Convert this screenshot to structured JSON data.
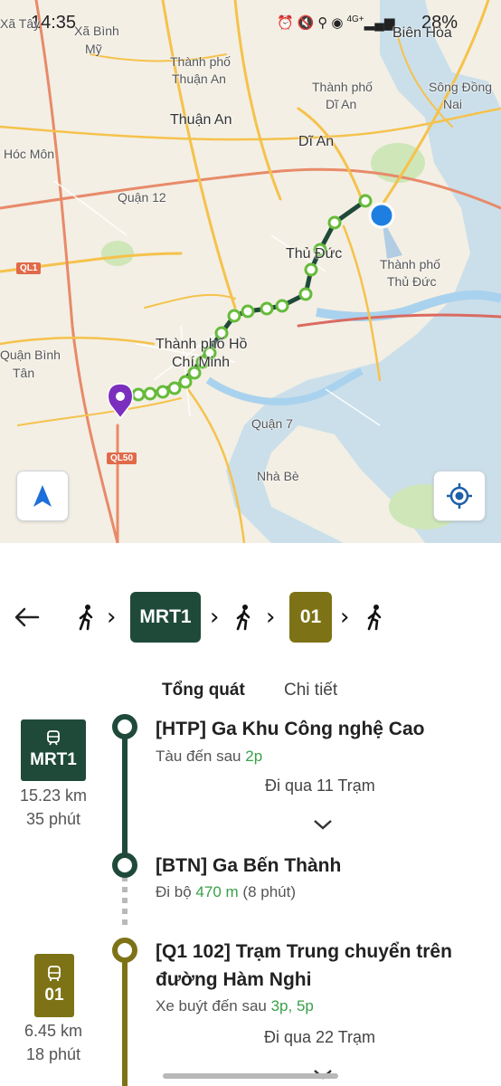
{
  "status_bar": {
    "time": "14:35",
    "signal_label": "4G+",
    "battery": "28%"
  },
  "map": {
    "labels": [
      "Xã Tây",
      "Xã Bình",
      "Mỹ",
      "Thành phố",
      "Thuận An",
      "Thuận An",
      "Thành phố",
      "Dĩ An",
      "Dĩ An",
      "Biên Hòa",
      "Sông Đồng",
      "Nai",
      "Hóc Môn",
      "Quận 12",
      "Thủ Đức",
      "Thành phố",
      "Thủ Đức",
      "Thành phố Hồ",
      "Chí Minh",
      "Quận Bình",
      "Tân",
      "Quận 7",
      "Nhà Bè"
    ],
    "shields": [
      "QL1",
      "QL50"
    ],
    "colors": {
      "route": "#1f4a3a",
      "walk": "#66bb3a",
      "origin": "#7b2fbe",
      "current": "#1e7fe0"
    },
    "navigate_icon": "navigation-arrow-icon",
    "locate_icon": "my-location-icon"
  },
  "route_bar": {
    "back_icon": "arrow-left-icon",
    "steps": [
      {
        "type": "walk",
        "icon": "walk-icon"
      },
      {
        "type": "line",
        "label": "MRT1",
        "color": "#1f4a3a"
      },
      {
        "type": "walk",
        "icon": "walk-icon"
      },
      {
        "type": "line",
        "label": "01",
        "color": "#7d7316"
      },
      {
        "type": "walk",
        "icon": "walk-icon"
      }
    ],
    "separator": "›"
  },
  "tabs": [
    {
      "label": "Tổng quát",
      "active": true
    },
    {
      "label": "Chi tiết",
      "active": false
    }
  ],
  "legs": [
    {
      "line": "MRT1",
      "color": "#1f4a3a",
      "distance": "15.23 km",
      "duration": "35 phút",
      "stop_from": "[HTP] Ga Khu Công nghệ Cao",
      "arrival_prefix": "Tàu đến sau ",
      "arrival_value": "2p",
      "pass_through": "Đi qua 11 Trạm",
      "stop_to": "[BTN] Ga Bến Thành"
    },
    {
      "line": "01",
      "color": "#7d7316",
      "distance": "6.45 km",
      "duration": "18 phút",
      "stop_from": "[Q1 102] Trạm Trung chuyển trên",
      "stop_from_2": "đường Hàm Nghi",
      "arrival_prefix": "Xe buýt đến sau ",
      "arrival_value": "3p, 5p",
      "pass_through": "Đi qua 22 Trạm"
    }
  ],
  "walk_transfer": {
    "prefix": "Đi bộ ",
    "distance": "470 m",
    "duration": "(8 phút)"
  }
}
